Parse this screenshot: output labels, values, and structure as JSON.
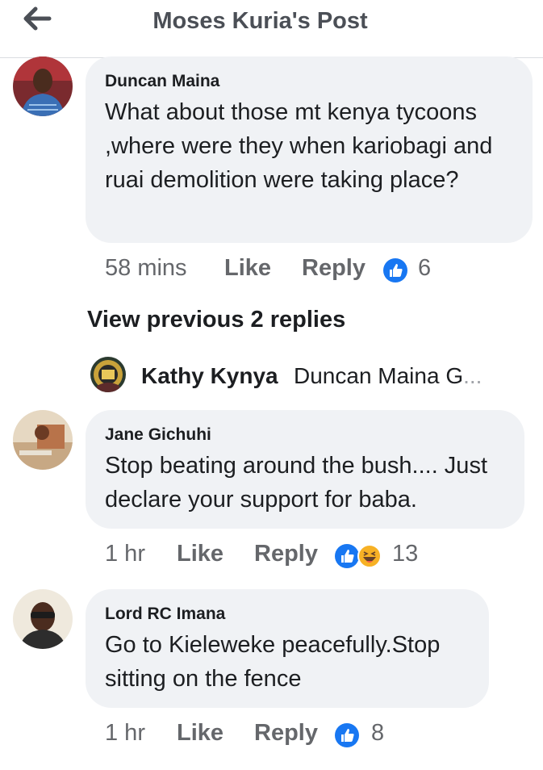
{
  "header": {
    "back_icon": "arrow-left-icon",
    "title": "Moses Kuria's Post"
  },
  "colors": {
    "like_blue": "#1877f2",
    "bubble_bg": "#f0f2f5",
    "meta_gray": "#65676b"
  },
  "comments": [
    {
      "author": "Duncan Maina",
      "text": "What about those mt kenya tycoons ,where were they when kariobagi and ruai demolition were taking place?",
      "time": "58 mins",
      "like_label": "Like",
      "reply_label": "Reply",
      "reactions": [
        "like-icon"
      ],
      "reaction_count": "6"
    },
    {
      "author": "Jane Gichuhi",
      "text": "Stop beating around the bush.... Just declare your support for baba.",
      "time": "1 hr",
      "like_label": "Like",
      "reply_label": "Reply",
      "reactions": [
        "like-icon",
        "haha-icon"
      ],
      "reaction_count": "13"
    },
    {
      "author": "Lord RC Imana",
      "text": "Go to Kieleweke peacefully.Stop sitting on the fence",
      "time": "1 hr",
      "like_label": "Like",
      "reply_label": "Reply",
      "reactions": [
        "like-icon"
      ],
      "reaction_count": "8"
    }
  ],
  "replies": {
    "view_previous": "View previous 2 replies",
    "last_reply": {
      "author": "Kathy Kynya",
      "text": "Duncan Maina G",
      "ellipsis": "..."
    }
  }
}
